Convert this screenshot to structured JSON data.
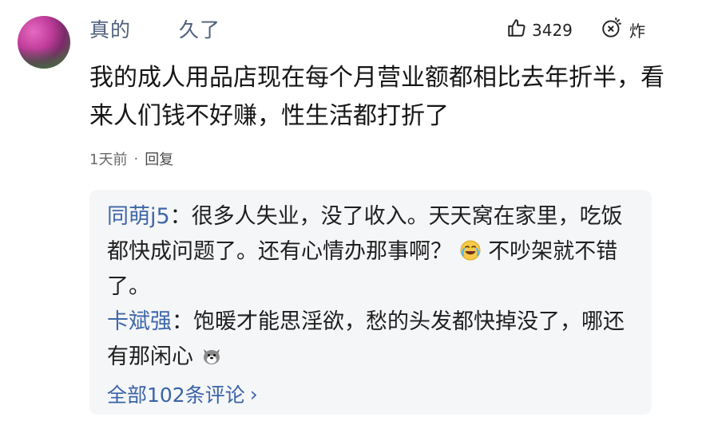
{
  "comment": {
    "username_prefix": "真的",
    "username_suffix": "久了",
    "like_count": "3429",
    "bomb_label": "炸",
    "text": "我的成人用品店现在每个月营业额都相比去年折半，看来人们钱不好赚，性生活都打折了",
    "time": "1天前",
    "dot": "·",
    "reply_label": "回复"
  },
  "replies": [
    {
      "name": "同萌j5",
      "sep": "：",
      "text_before_emoji": "很多人失业，没了收入。天天窝在家里，吃饭都快成问题了。还有心情办那事啊？",
      "text_after_emoji": "不吵架就不错了。"
    },
    {
      "name": "卡斌强",
      "sep": "：",
      "text": "饱暖才能思淫欲，愁的头发都快掉没了，哪还有那闲心"
    }
  ],
  "more": {
    "label": "全部102条评论",
    "chevron": "›"
  },
  "icons": {
    "like": "thumbs-up-icon",
    "bomb": "bomb-icon",
    "reply1_emoji": "laugh-cry-emoji-icon",
    "reply2_emoji": "dog-emoji-icon"
  }
}
